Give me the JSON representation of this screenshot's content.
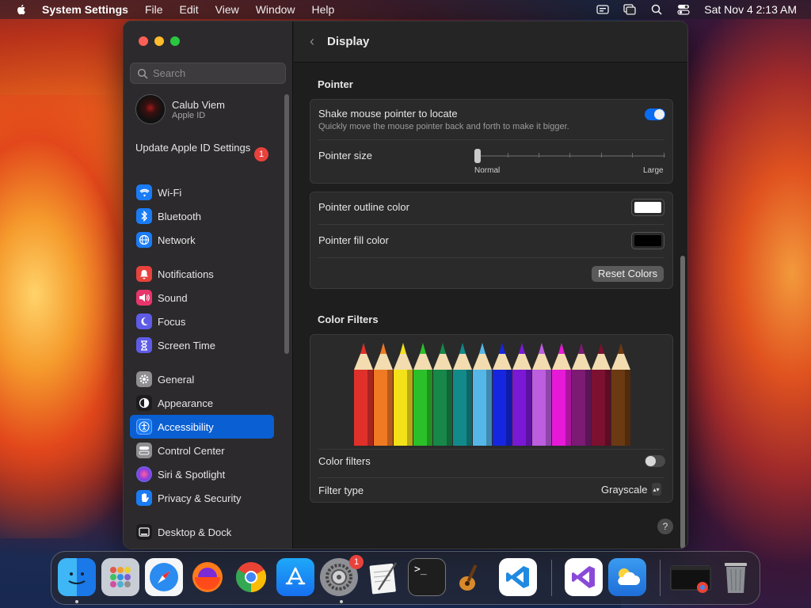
{
  "menubar": {
    "app_name": "System Settings",
    "menus": [
      "File",
      "Edit",
      "View",
      "Window",
      "Help"
    ],
    "datetime": "Sat Nov 4  2:13 AM"
  },
  "sidebar": {
    "search_placeholder": "Search",
    "profile": {
      "name": "Calub Viem",
      "subtitle": "Apple ID"
    },
    "update": {
      "label": "Update Apple ID Settings",
      "badge": "1"
    },
    "items": [
      {
        "label": "Wi-Fi",
        "icon": "wifi-icon",
        "color": "#1a7cf5"
      },
      {
        "label": "Bluetooth",
        "icon": "bluetooth-icon",
        "color": "#1a7cf5"
      },
      {
        "label": "Network",
        "icon": "globe-icon",
        "color": "#1a7cf5"
      },
      {
        "label": "Notifications",
        "icon": "bell-icon",
        "color": "#e8423d"
      },
      {
        "label": "Sound",
        "icon": "speaker-icon",
        "color": "#e8356b"
      },
      {
        "label": "Focus",
        "icon": "moon-icon",
        "color": "#5e5ce6"
      },
      {
        "label": "Screen Time",
        "icon": "hourglass-icon",
        "color": "#5e5ce6"
      },
      {
        "label": "General",
        "icon": "gear-icon",
        "color": "#8e8e93"
      },
      {
        "label": "Appearance",
        "icon": "appearance-icon",
        "color": "#1c1c1e"
      },
      {
        "label": "Accessibility",
        "icon": "accessibility-icon",
        "color": "#1a7cf5",
        "selected": true
      },
      {
        "label": "Control Center",
        "icon": "control-center-icon",
        "color": "#8e8e93"
      },
      {
        "label": "Siri & Spotlight",
        "icon": "siri-icon",
        "color": "#b03adf"
      },
      {
        "label": "Privacy & Security",
        "icon": "hand-icon",
        "color": "#1a7cf5"
      },
      {
        "label": "Desktop & Dock",
        "icon": "dock-icon",
        "color": "#1c1c1e"
      }
    ]
  },
  "content": {
    "title": "Display",
    "pointer_section": {
      "title": "Pointer",
      "shake_label": "Shake mouse pointer to locate",
      "shake_sub": "Quickly move the mouse pointer back and forth to make it bigger.",
      "shake_enabled": true,
      "size_label": "Pointer size",
      "size_min_label": "Normal",
      "size_max_label": "Large",
      "size_value": 0.0,
      "outline_label": "Pointer outline color",
      "outline_color": "#ffffff",
      "fill_label": "Pointer fill color",
      "fill_color": "#000000",
      "reset_label": "Reset Colors"
    },
    "color_filters_section": {
      "title": "Color Filters",
      "pencil_colors": [
        "#e0302a",
        "#ef7a23",
        "#f3e21a",
        "#2bc02a",
        "#17874a",
        "#138a8a",
        "#55b7e8",
        "#1626e0",
        "#7a18d6",
        "#bd5de0",
        "#e61ad6",
        "#7c1a74",
        "#7c1030",
        "#6b3a12"
      ],
      "filters_label": "Color filters",
      "filters_enabled": false,
      "filter_type_label": "Filter type",
      "filter_type_value": "Grayscale"
    },
    "help_label": "?"
  },
  "dock": {
    "apps": [
      {
        "name": "Finder",
        "icon": "finder-icon",
        "running": true
      },
      {
        "name": "Launchpad",
        "icon": "launchpad-icon"
      },
      {
        "name": "Safari",
        "icon": "safari-icon"
      },
      {
        "name": "Firefox",
        "icon": "firefox-icon"
      },
      {
        "name": "Chrome",
        "icon": "chrome-icon"
      },
      {
        "name": "App Store",
        "icon": "app-store-icon"
      },
      {
        "name": "System Settings",
        "icon": "system-settings-icon",
        "badge": "1",
        "running": true
      },
      {
        "name": "TextEdit",
        "icon": "textedit-icon"
      },
      {
        "name": "Terminal",
        "icon": "terminal-icon"
      },
      {
        "name": "GarageBand",
        "icon": "guitar-icon"
      },
      {
        "name": "Visual Studio Code",
        "icon": "vscode-icon"
      },
      {
        "name": "Visual Studio",
        "icon": "visual-studio-icon"
      },
      {
        "name": "Weather",
        "icon": "weather-icon"
      },
      {
        "name": "Chrome Window",
        "icon": "window-thumbnail-icon"
      },
      {
        "name": "Trash",
        "icon": "trash-icon"
      }
    ]
  }
}
